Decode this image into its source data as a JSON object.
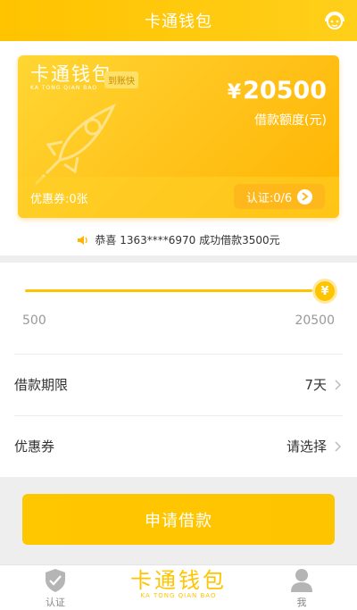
{
  "header": {
    "title": "卡通钱包",
    "icon": "customer-service-icon"
  },
  "card": {
    "logo_cn": "卡通钱包",
    "logo_en": "KA TONG QIAN BAO",
    "badge": "到账快",
    "currency_symbol": "¥",
    "amount": "20500",
    "amount_label": "借款额度(元)",
    "coupon_text": "优惠券:0张",
    "verify_text": "认证:0/6"
  },
  "notice": {
    "text": "恭喜 1363****6970 成功借款3500元",
    "icon": "speaker-icon"
  },
  "slider": {
    "min_label": "500",
    "max_label": "20500",
    "thumb_symbol": "¥",
    "level": 1.0
  },
  "rows": [
    {
      "label": "借款期限",
      "value": "7天"
    },
    {
      "label": "优惠券",
      "value": "请选择"
    }
  ],
  "apply_button": "申请借款",
  "tabbar": {
    "auth_label": "认证",
    "home_cn": "卡通钱包",
    "home_en": "KA TONG QIAN BAO",
    "me_label": "我"
  },
  "colors": {
    "accent": "#ffc400",
    "background_gray": "#eeeeee"
  }
}
